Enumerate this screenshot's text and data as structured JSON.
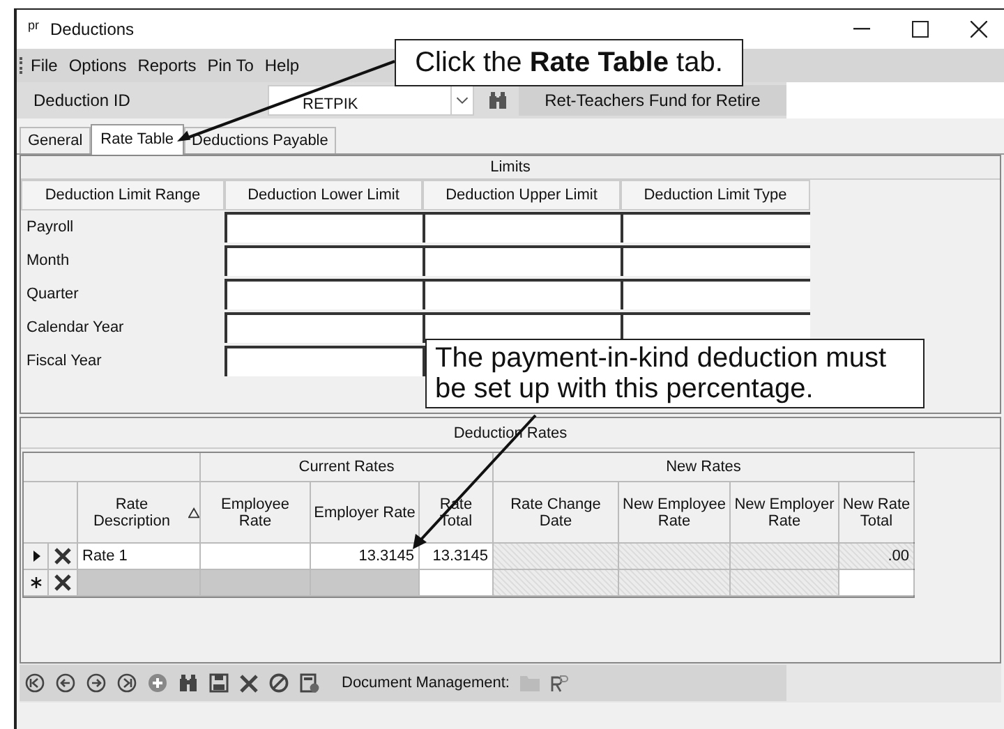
{
  "window": {
    "icon_text": "pr",
    "title": "Deductions"
  },
  "menu": [
    "File",
    "Options",
    "Reports",
    "Pin To",
    "Help"
  ],
  "id_bar": {
    "label": "Deduction ID",
    "value": "RETPIK",
    "description": "Ret-Teachers Fund for Retire"
  },
  "tabs": [
    {
      "label": "General",
      "selected": false
    },
    {
      "label": "Rate Table",
      "selected": true
    },
    {
      "label": "Deductions Payable",
      "selected": false
    }
  ],
  "limits": {
    "title": "Limits",
    "columns": [
      "Deduction Limit Range",
      "Deduction Lower Limit",
      "Deduction Upper Limit",
      "Deduction Limit Type"
    ],
    "rows": [
      "Payroll",
      "Month",
      "Quarter",
      "Calendar Year",
      "Fiscal Year"
    ]
  },
  "rates": {
    "title": "Deduction Rates",
    "groups": [
      "Current Rates",
      "New Rates"
    ],
    "columns": [
      "Rate Description",
      "Employee Rate",
      "Employer Rate",
      "Rate Total",
      "Rate Change Date",
      "New Employee Rate",
      "New Employer Rate",
      "New Rate Total"
    ],
    "rows": [
      {
        "kind": "current",
        "cells": [
          {
            "text": "Rate 1",
            "kind": "editable"
          },
          {
            "kind": "editable"
          },
          {
            "text": "13.3145",
            "kind": "editable"
          },
          {
            "text": "13.3145",
            "kind": "editable"
          },
          {
            "kind": "readonly"
          },
          {
            "kind": "readonly"
          },
          {
            "kind": "readonly"
          },
          {
            "text": ".00",
            "kind": "readonly"
          }
        ]
      },
      {
        "kind": "new",
        "cells": [
          {
            "kind": "inactive"
          },
          {
            "kind": "inactive"
          },
          {
            "kind": "inactive"
          },
          {
            "kind": "editable"
          },
          {
            "kind": "readonly"
          },
          {
            "kind": "readonly"
          },
          {
            "kind": "readonly"
          },
          {
            "kind": "editable"
          }
        ]
      }
    ]
  },
  "toolbar": {
    "document_label": "Document Management:"
  },
  "callouts": [
    {
      "text": "Click the **Rate Table** tab."
    },
    {
      "text": "The payment-in-kind deduction must be set up with this percentage."
    }
  ]
}
